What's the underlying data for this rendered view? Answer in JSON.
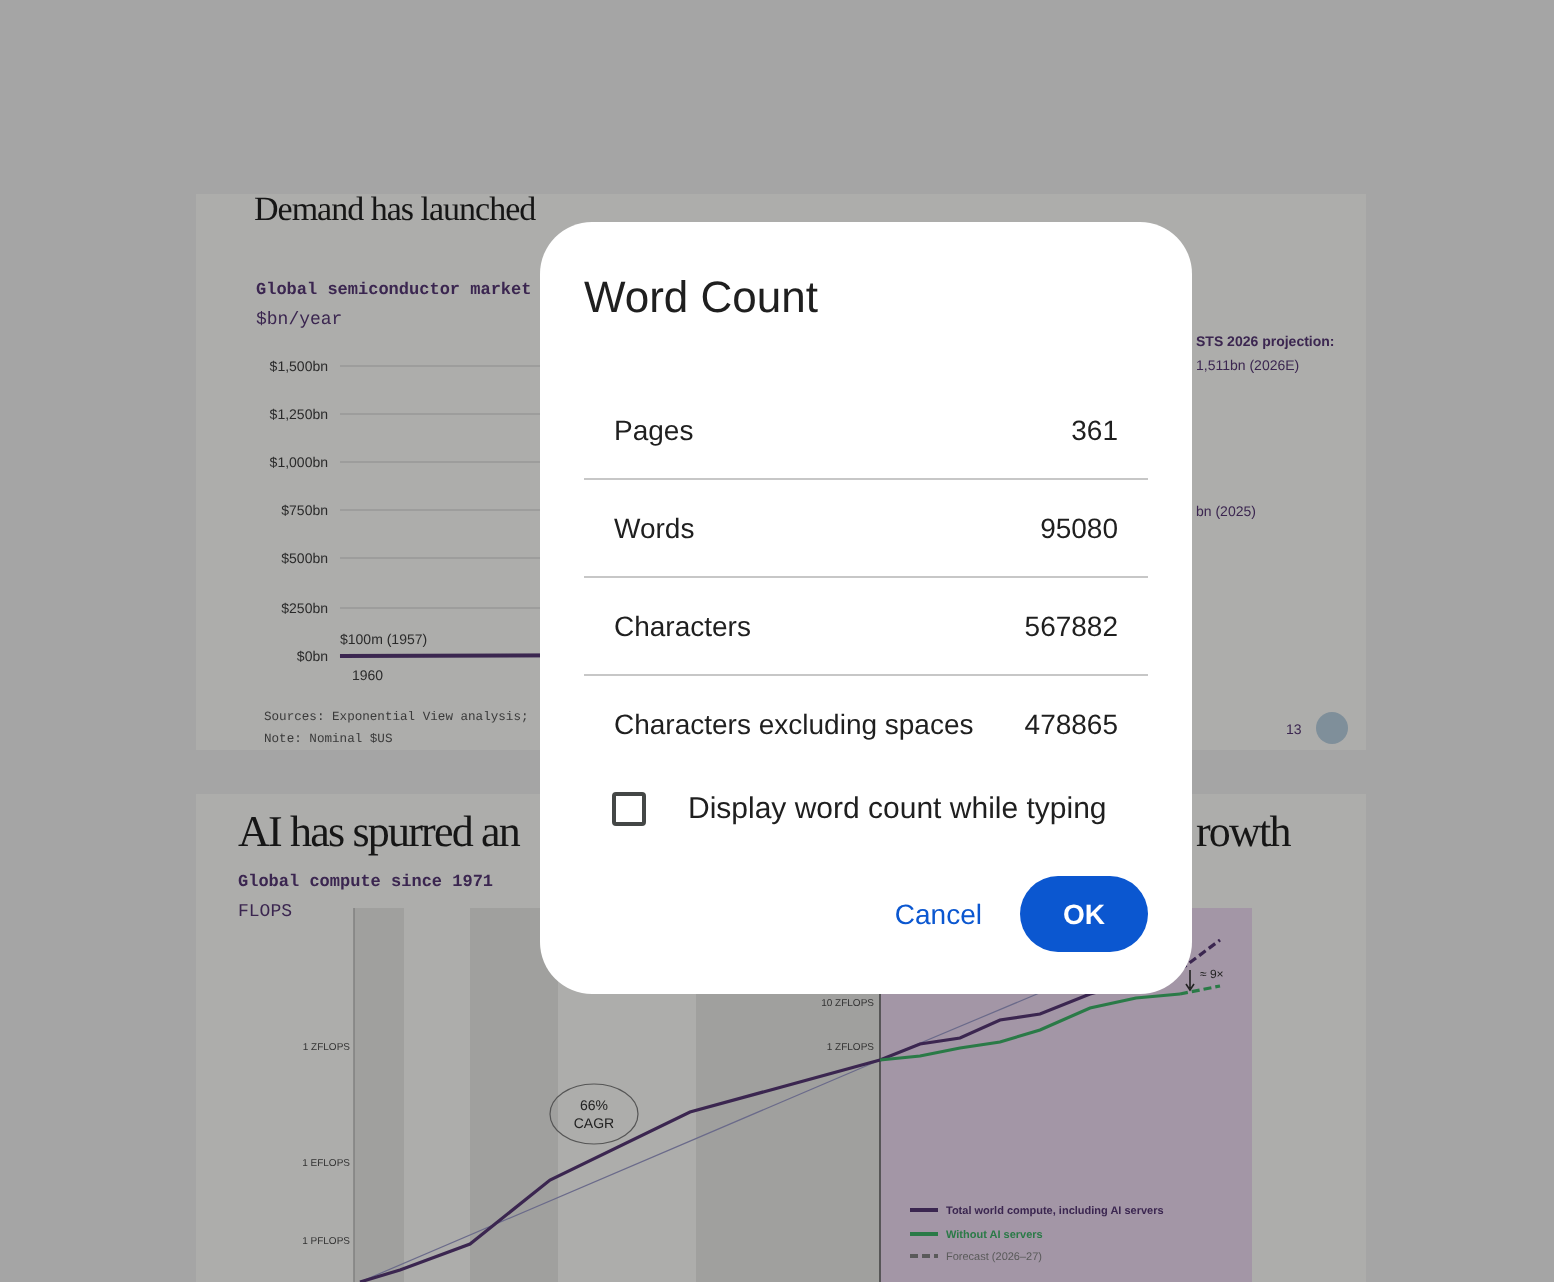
{
  "document": {
    "slides": [
      {
        "title": "Demand has launched",
        "subtitle": "Global semiconductor market",
        "unit": "$bn/year",
        "y_tick_labels": [
          "$1,500bn",
          "$1,250bn",
          "$1,000bn",
          "$750bn",
          "$500bn",
          "$250bn",
          "$0bn"
        ],
        "start_label": "$100m (1957)",
        "x_label": "1960",
        "side_notes": [
          "STS 2026 projection:",
          "1,511bn (2026E)",
          "bn (2025)"
        ],
        "sources": "Sources: Exponential View analysis;",
        "note": "Note: Nominal $US",
        "page_number": "13"
      },
      {
        "title_start": "AI has spurred an",
        "title_end": "rowth",
        "subtitle": "Global compute since 1971",
        "unit": "FLOPS",
        "y_tick_labels": [
          "1 ZFLOPS",
          "1 EFLOPS",
          "1 PFLOPS"
        ],
        "inset_tick_labels": [
          "10 ZFLOPS",
          "1 ZFLOPS"
        ],
        "cagr_label": [
          "66%",
          "CAGR"
        ],
        "gap_label": "≈ 9×",
        "legend": [
          {
            "label": "Total world compute, including AI servers",
            "color": "#3b2650",
            "kind": "solid"
          },
          {
            "label": "Without AI servers",
            "color": "#2a7a47",
            "kind": "solid"
          },
          {
            "label": "Forecast (2026–27)",
            "color": "#5a5a5a",
            "kind": "dashed"
          }
        ]
      }
    ]
  },
  "dialog": {
    "title": "Word Count",
    "stats": [
      {
        "label": "Pages",
        "value": "361"
      },
      {
        "label": "Words",
        "value": "95080"
      },
      {
        "label": "Characters",
        "value": "567882"
      },
      {
        "label": "Characters excluding spaces",
        "value": "478865"
      }
    ],
    "checkbox": {
      "label": "Display word count while typing",
      "checked": false
    },
    "buttons": [
      {
        "label": "Cancel",
        "kind": "text"
      },
      {
        "label": "OK",
        "kind": "filled"
      }
    ]
  }
}
